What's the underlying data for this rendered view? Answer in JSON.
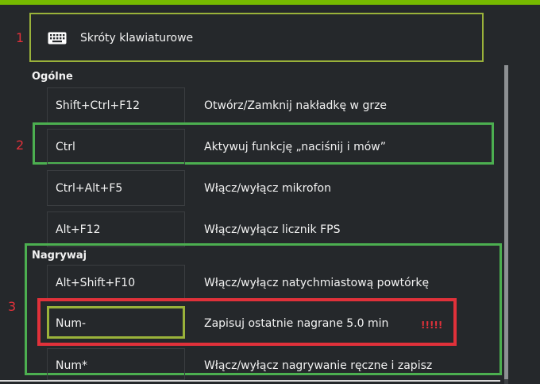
{
  "header": {
    "title": "Skróty klawiaturowe",
    "icon": "keyboard-icon"
  },
  "annotations": {
    "label1": "1",
    "label2": "2",
    "label3": "3",
    "warning": "!!!!!"
  },
  "colors": {
    "accent": "#76b900",
    "green_box": "#4caf50",
    "red_box": "#e0313a",
    "olive_box": "#9ab23a"
  },
  "sections": [
    {
      "title": "Ogólne",
      "rows": [
        {
          "key": "Shift+Ctrl+F12",
          "action": "Otwórz/Zamknij nakładkę w grze"
        },
        {
          "key": "Ctrl",
          "action": "Aktywuj funkcję „naciśnij i mów”"
        },
        {
          "key": "Ctrl+Alt+F5",
          "action": "Włącz/wyłącz mikrofon"
        },
        {
          "key": "Alt+F12",
          "action": "Włącz/wyłącz licznik FPS"
        }
      ]
    },
    {
      "title": "Nagrywaj",
      "rows": [
        {
          "key": "Alt+Shift+F10",
          "action": "Włącz/wyłącz natychmiastową powtórkę"
        },
        {
          "key": "Num-",
          "action": "Zapisuj ostatnie nagrane 5.0 min"
        },
        {
          "key": "Num*",
          "action": "Włącz/wyłącz nagrywanie ręczne i zapisz"
        }
      ]
    }
  ]
}
